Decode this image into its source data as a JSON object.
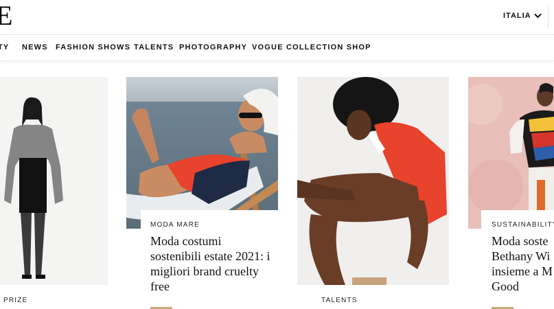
{
  "header": {
    "logo": "E",
    "edition": "ITALIA"
  },
  "nav": {
    "items": [
      "TY",
      "NEWS",
      "FASHION SHOWS",
      "TALENTS",
      "PHOTOGRAPHY",
      "VOGUE COLLECTION SHOP"
    ]
  },
  "cards": [
    {
      "category": "PRIZE"
    },
    {
      "category": "MODA MARE",
      "headline_lines": [
        "Moda costumi",
        "sostenibili estate 2021: i",
        "migliori brand cruelty",
        "free"
      ]
    },
    {
      "category": "TALENTS"
    },
    {
      "category": "SUSTAINABILITY",
      "headline_lines": [
        "Moda soste",
        "Bethany Wi",
        "insieme a M",
        "Good"
      ]
    }
  ],
  "colors": {
    "accent_rule": "#c9a97a",
    "swimsuit_red": "#e8432c",
    "sea_blue": "#7c8fa0"
  },
  "icons": [
    "chevron-down-icon"
  ]
}
